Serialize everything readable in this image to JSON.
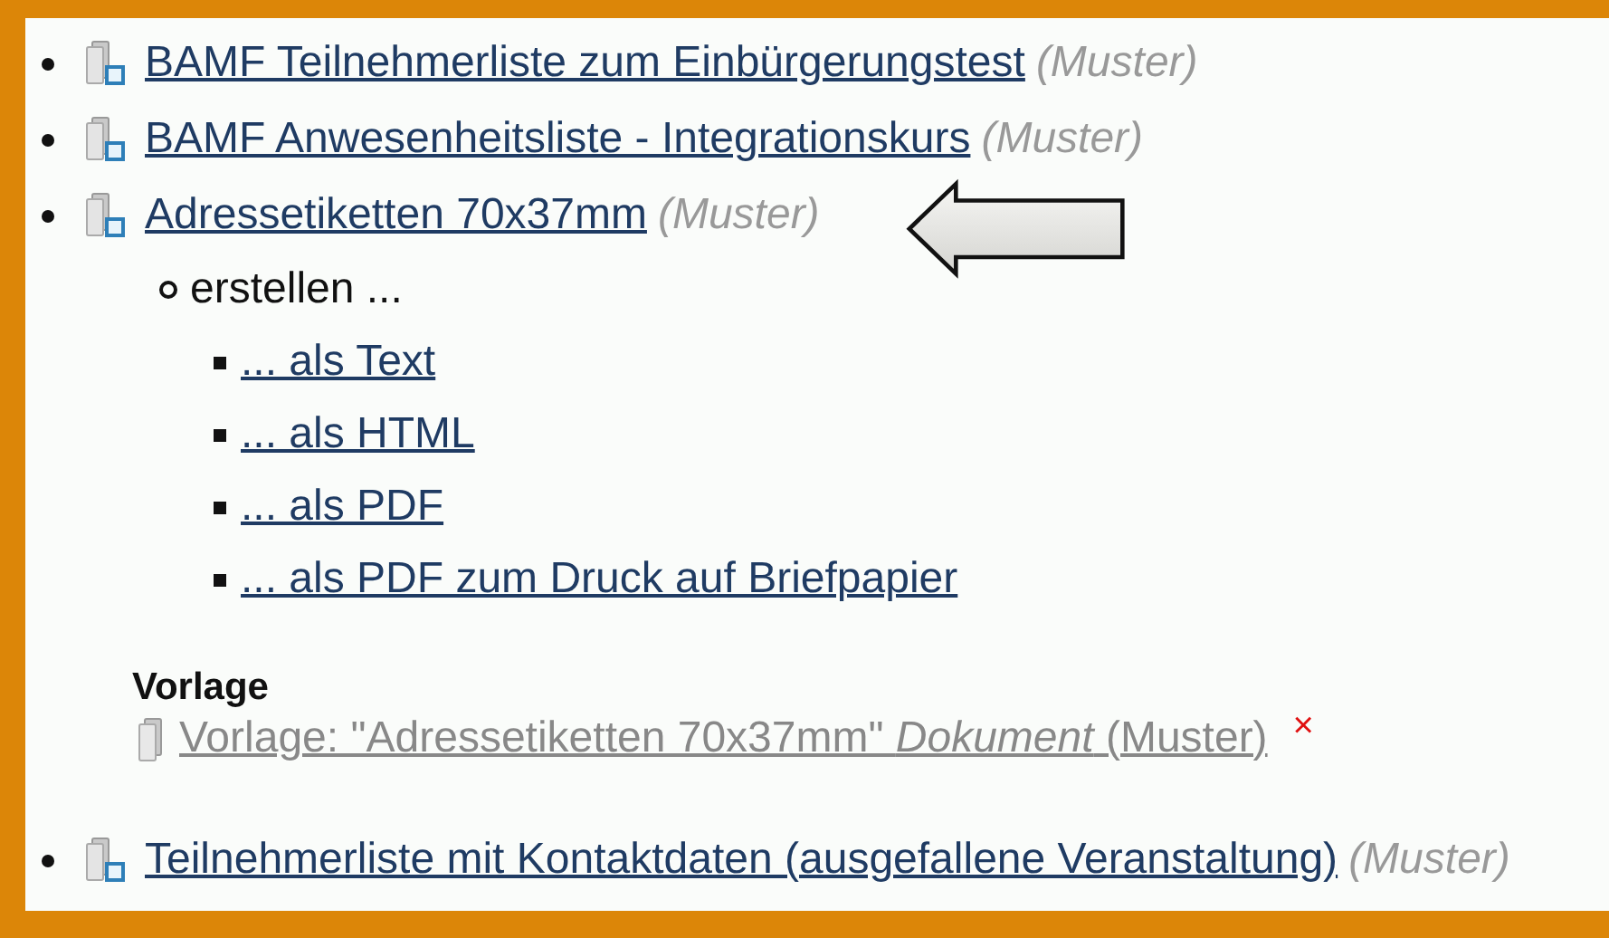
{
  "documents": [
    {
      "title": "BAMF Teilnehmerliste zum Einbürgerungstest",
      "note": "(Muster)",
      "pointed_at": false
    },
    {
      "title": "BAMF Anwesenheitsliste - Integrationskurs",
      "note": "(Muster)",
      "pointed_at": false
    },
    {
      "title": "Adressetiketten 70x37mm",
      "note": "(Muster)",
      "pointed_at": true,
      "children": [
        {
          "label": "erstellen ...",
          "children": [
            {
              "title": "... als Text"
            },
            {
              "title": "... als HTML"
            },
            {
              "title": "... als PDF"
            },
            {
              "title": "... als PDF zum Druck auf Briefpapier"
            }
          ]
        }
      ],
      "template": {
        "heading": "Vorlage",
        "link": "Vorlage: \"Adressetiketten 70x37mm\" *Dokument* (Muster)",
        "delete": "×"
      }
    },
    {
      "title": "Teilnehmerliste mit Kontaktdaten (ausgefallene Veranstaltung)",
      "note": "(Muster)",
      "pointed_at": false
    }
  ]
}
